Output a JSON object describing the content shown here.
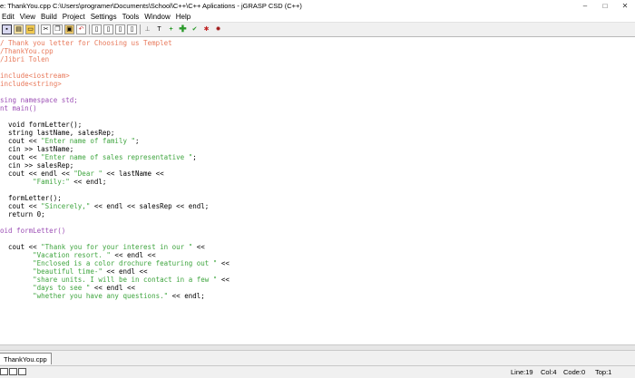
{
  "window": {
    "title": "e: ThankYou.cpp  C:\\Users\\programer\\Documents\\School\\C++\\C++ Aplications - jGRASP CSD (C++)",
    "minimize": "–",
    "maximize": "□",
    "close": "✕"
  },
  "menu": [
    "Edit",
    "View",
    "Build",
    "Project",
    "Settings",
    "Tools",
    "Window",
    "Help"
  ],
  "toolbar_icons": [
    "save-icon",
    "open-icon",
    "folder-icon",
    "cut-icon",
    "copy-icon",
    "paste-icon",
    "undo-icon",
    "doc-icon",
    "doc2-icon",
    "doc3-icon",
    "doc4-icon",
    "pin-icon",
    "step-icon",
    "add-icon",
    "add-green-icon",
    "check-icon",
    "run-icon",
    "debug-icon"
  ],
  "code_lines": [
    [
      {
        "t": "/ Thank you letter for Choosing us Templet",
        "c": "comment"
      }
    ],
    [
      {
        "t": "/ThankYou.cpp",
        "c": "comment"
      }
    ],
    [
      {
        "t": "/Jibri Tolen",
        "c": "comment"
      }
    ],
    [
      {
        "t": "",
        "c": "norm"
      }
    ],
    [
      {
        "t": "include<iostream>",
        "c": "pre"
      }
    ],
    [
      {
        "t": "include<string>",
        "c": "pre"
      }
    ],
    [
      {
        "t": "",
        "c": "norm"
      }
    ],
    [
      {
        "t": "sing namespace std;",
        "c": "kw"
      }
    ],
    [
      {
        "t": "nt main()",
        "c": "kw"
      }
    ],
    [
      {
        "t": "",
        "c": "norm"
      }
    ],
    [
      {
        "t": "  void formLetter();",
        "c": "norm"
      }
    ],
    [
      {
        "t": "  string lastName, salesRep;",
        "c": "norm"
      }
    ],
    [
      {
        "t": "  cout << ",
        "c": "norm"
      },
      {
        "t": "\"Enter name of family \"",
        "c": "str"
      },
      {
        "t": ";",
        "c": "norm"
      }
    ],
    [
      {
        "t": "  cin >> lastName;",
        "c": "norm"
      }
    ],
    [
      {
        "t": "  cout << ",
        "c": "norm"
      },
      {
        "t": "\"Enter name of sales representative \"",
        "c": "str"
      },
      {
        "t": ";",
        "c": "norm"
      }
    ],
    [
      {
        "t": "  cin >> salesRep;",
        "c": "norm"
      }
    ],
    [
      {
        "t": "  cout << endl << ",
        "c": "norm"
      },
      {
        "t": "\"Dear \"",
        "c": "str"
      },
      {
        "t": " << lastName <<",
        "c": "norm"
      }
    ],
    [
      {
        "t": "        ",
        "c": "norm"
      },
      {
        "t": "\"Family:\"",
        "c": "str"
      },
      {
        "t": " << endl;",
        "c": "norm"
      }
    ],
    [
      {
        "t": "",
        "c": "norm"
      }
    ],
    [
      {
        "t": "  formLetter();",
        "c": "norm"
      }
    ],
    [
      {
        "t": "  cout << ",
        "c": "norm"
      },
      {
        "t": "\"Sincerely,\"",
        "c": "str"
      },
      {
        "t": " << endl << salesRep << endl;",
        "c": "norm"
      }
    ],
    [
      {
        "t": "  return 0;",
        "c": "norm"
      }
    ],
    [
      {
        "t": "",
        "c": "norm"
      }
    ],
    [
      {
        "t": "oid formLetter()",
        "c": "kw"
      }
    ],
    [
      {
        "t": "",
        "c": "norm"
      }
    ],
    [
      {
        "t": "  cout << ",
        "c": "norm"
      },
      {
        "t": "\"Thank you for your interest in our \"",
        "c": "str"
      },
      {
        "t": " <<",
        "c": "norm"
      }
    ],
    [
      {
        "t": "        ",
        "c": "norm"
      },
      {
        "t": "\"Vacation resort. \"",
        "c": "str"
      },
      {
        "t": " << endl <<",
        "c": "norm"
      }
    ],
    [
      {
        "t": "        ",
        "c": "norm"
      },
      {
        "t": "\"Enclosed is a color drochure featuring out \"",
        "c": "str"
      },
      {
        "t": " <<",
        "c": "norm"
      }
    ],
    [
      {
        "t": "        ",
        "c": "norm"
      },
      {
        "t": "\"beautiful time-\"",
        "c": "str"
      },
      {
        "t": " << endl <<",
        "c": "norm"
      }
    ],
    [
      {
        "t": "        ",
        "c": "norm"
      },
      {
        "t": "\"share units. I will be in contact in a few \"",
        "c": "str"
      },
      {
        "t": " <<",
        "c": "norm"
      }
    ],
    [
      {
        "t": "        ",
        "c": "norm"
      },
      {
        "t": "\"days to see \"",
        "c": "str"
      },
      {
        "t": " << endl <<",
        "c": "norm"
      }
    ],
    [
      {
        "t": "        ",
        "c": "norm"
      },
      {
        "t": "\"whether you have any questions.\"",
        "c": "str"
      },
      {
        "t": " << endl;",
        "c": "norm"
      }
    ]
  ],
  "file_tab": "ThankYou.cpp",
  "status": {
    "line": "Line:19",
    "col": "Col:4",
    "code": "Code:0",
    "top": "Top:1"
  },
  "colors": {
    "comment": "#e8795b",
    "string": "#3fa53f",
    "keyword": "#9c4fb5"
  }
}
